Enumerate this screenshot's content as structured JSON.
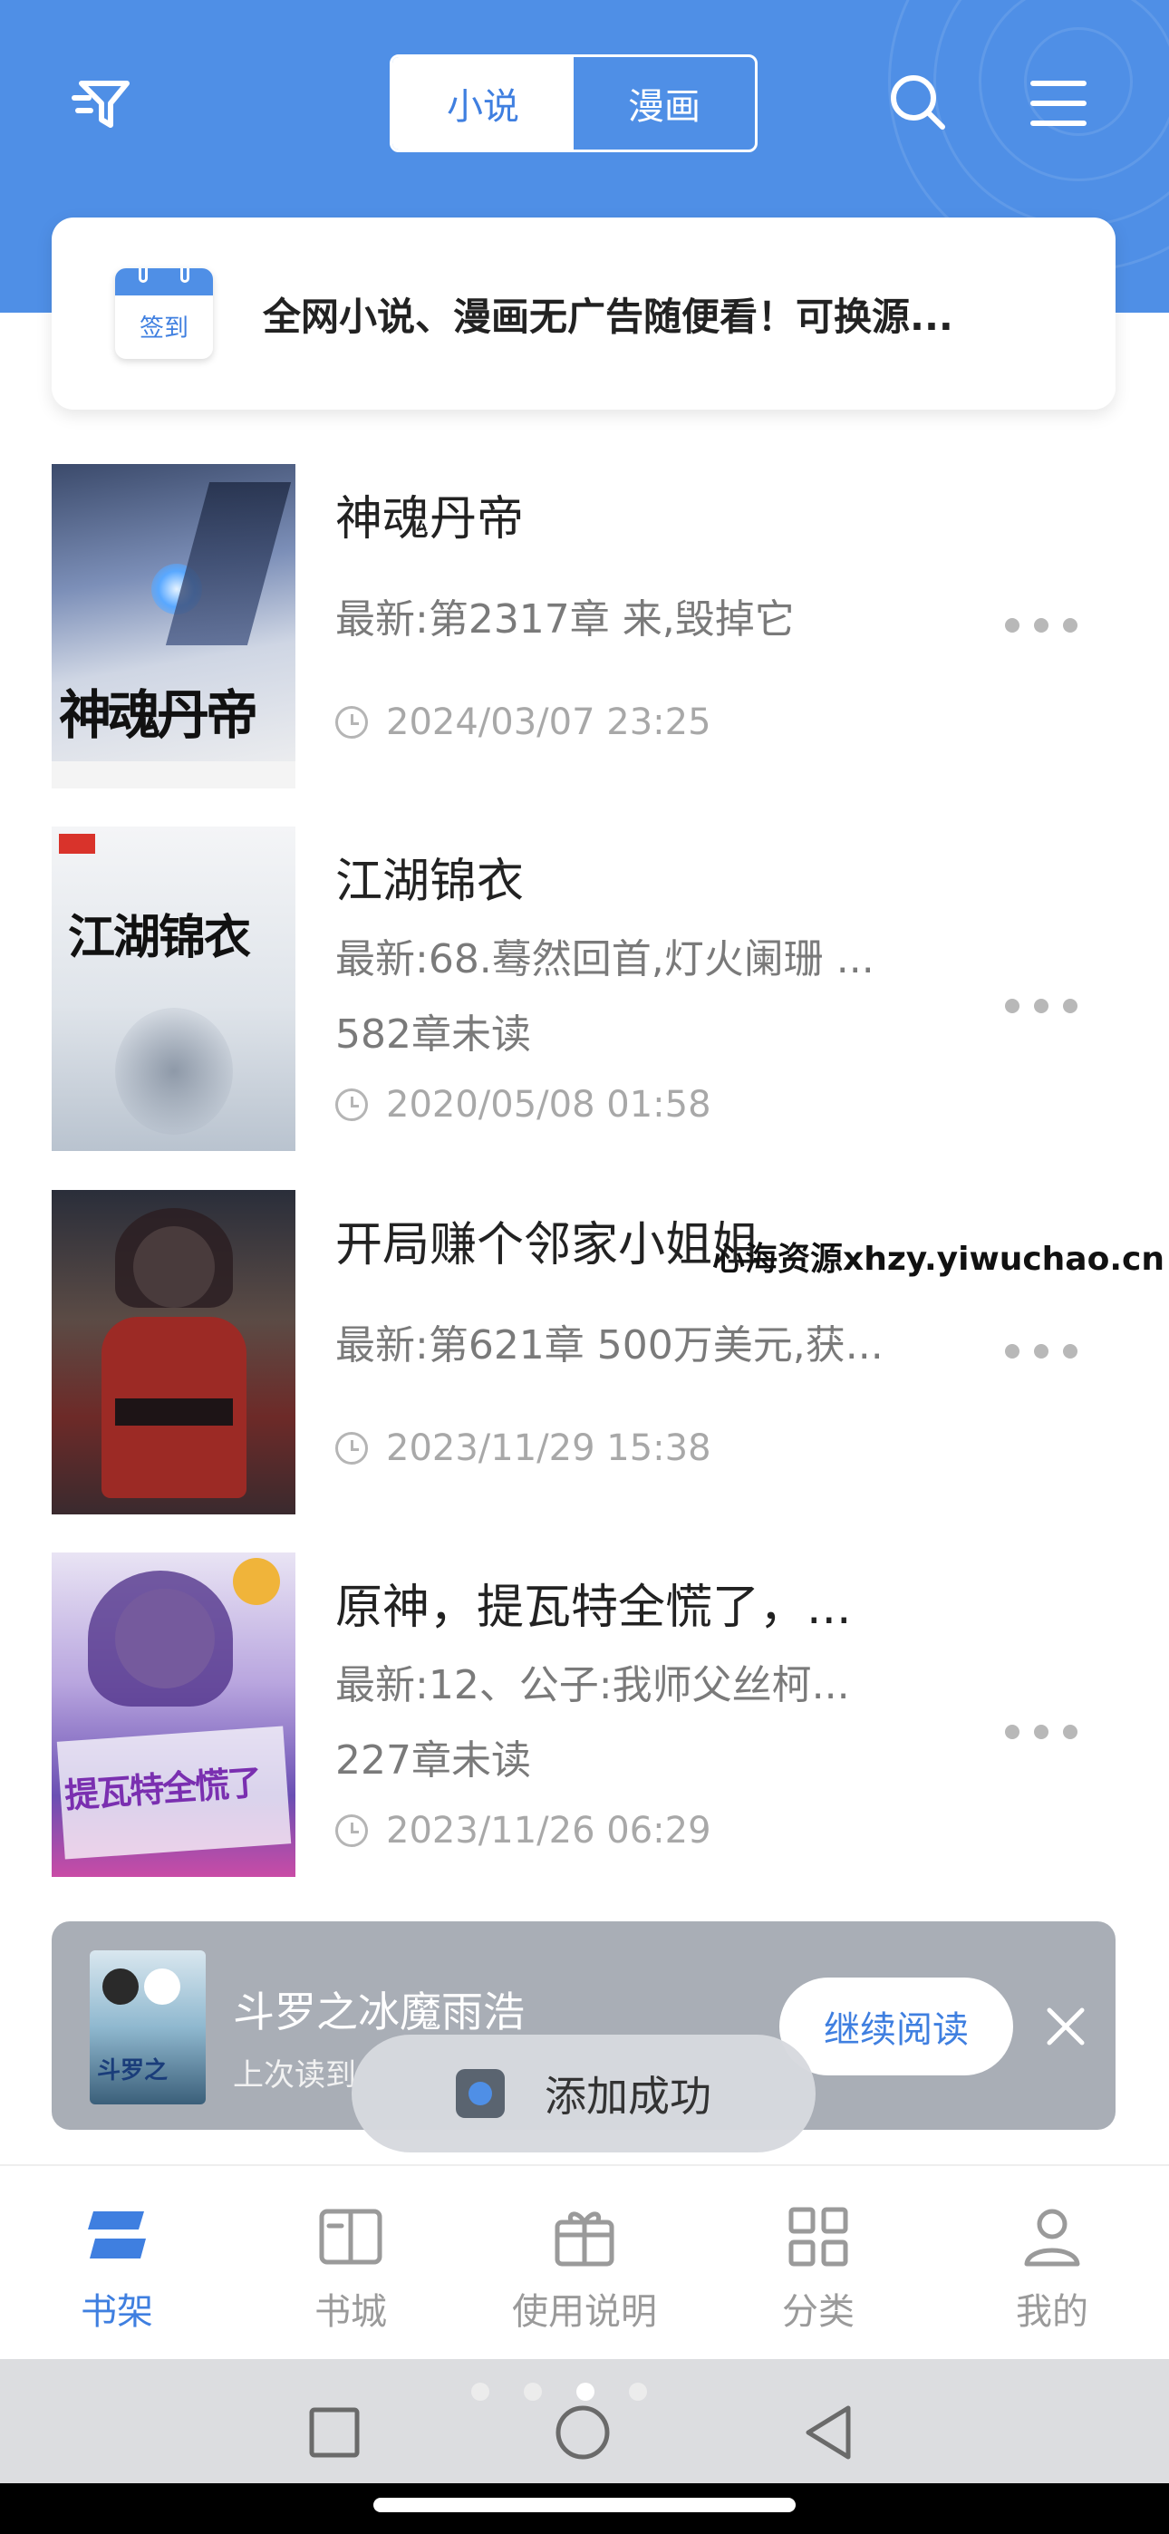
{
  "header": {
    "tabs": [
      {
        "label": "小说",
        "active": true
      },
      {
        "label": "漫画",
        "active": false
      }
    ],
    "icons": [
      "filter-icon",
      "search-icon",
      "menu-icon"
    ],
    "accent_color": "#4f8fe6"
  },
  "banner": {
    "calendar_label": "签到",
    "text": "全网小说、漫画无广告随便看！可换源..."
  },
  "books": [
    {
      "title": "神魂丹帝",
      "cover_text": "神魂丹帝",
      "latest": "最新:第2317章 来,毁掉它",
      "unread": "",
      "time": "2024/03/07 23:25"
    },
    {
      "title": "江湖锦衣",
      "cover_text": "江湖锦衣",
      "latest": "最新:68.蓦然回首,灯火阑珊 ...",
      "unread": "582章未读",
      "time": "2020/05/08 01:58"
    },
    {
      "title": "开局赚个邻家小姐姐",
      "cover_text": "",
      "latest": "最新:第621章 500万美元,获...",
      "unread": "",
      "time": "2023/11/29 15:38"
    },
    {
      "title": "原神，提瓦特全慌了，...",
      "cover_text": "提瓦特全慌了",
      "latest": "最新:12、公子:我师父丝柯...",
      "unread": "227章未读",
      "time": "2023/11/26 06:29"
    }
  ],
  "watermark": "心海资源xhzy.yiwuchao.cn",
  "continue_reading": {
    "title": "斗罗之冰魔雨浩",
    "last_read": "上次读到",
    "button": "继续阅读",
    "cover_text": "斗罗之"
  },
  "toast": {
    "text": "添加成功"
  },
  "tabbar": [
    {
      "label": "书架",
      "icon": "bookshelf-icon",
      "active": true
    },
    {
      "label": "书城",
      "icon": "book-icon",
      "active": false
    },
    {
      "label": "使用说明",
      "icon": "gift-icon",
      "active": false
    },
    {
      "label": "分类",
      "icon": "grid-icon",
      "active": false
    },
    {
      "label": "我的",
      "icon": "user-icon",
      "active": false
    }
  ],
  "navbar": {
    "icons": [
      "square-icon",
      "circle-icon",
      "back-triangle-icon"
    ],
    "page_dots": 4,
    "active_dot": 3
  }
}
